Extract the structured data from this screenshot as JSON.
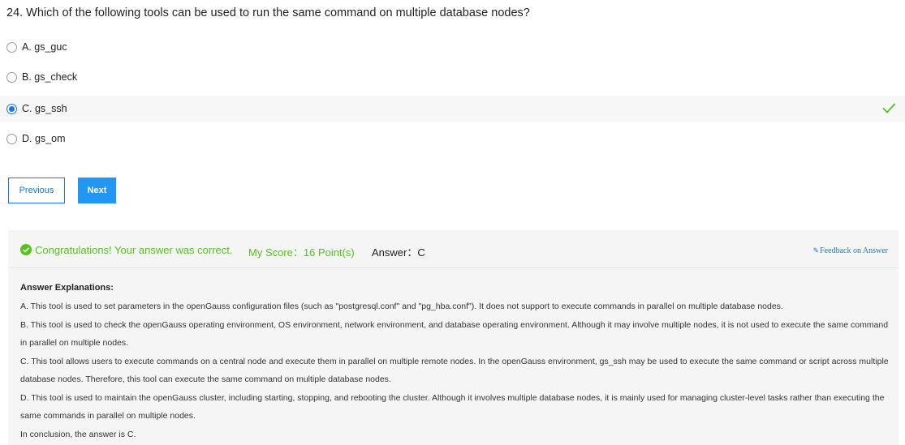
{
  "question": {
    "text": "24. Which of the following tools can be used to run the same command on multiple database nodes?"
  },
  "options": [
    {
      "label": "A. gs_guc",
      "selected": false,
      "correct": false
    },
    {
      "label": "B. gs_check",
      "selected": false,
      "correct": false
    },
    {
      "label": "C. gs_ssh",
      "selected": true,
      "correct": true
    },
    {
      "label": "D. gs_om",
      "selected": false,
      "correct": false
    }
  ],
  "buttons": {
    "previous": "Previous",
    "next": "Next"
  },
  "result": {
    "message": "Congratulations! Your answer was correct.",
    "score": "My Score：16 Point(s)",
    "answer": "Answer：C",
    "feedback": "Feedback on Answer"
  },
  "explanation": {
    "title": "Answer Explanations:",
    "lines": [
      "A. This tool is used to set parameters in the openGauss configuration files (such as \"postgresql.conf\" and \"pg_hba.conf\"). It does not support to execute commands in parallel on multiple database nodes.",
      "B. This tool is used to check the openGauss operating environment, OS environment, network environment, and database operating environment. Although it may involve multiple nodes, it is not used to execute the same command in parallel on multiple nodes.",
      "C. This tool allows users to execute commands on a central node and execute them in parallel on multiple remote nodes. In the openGauss environment, gs_ssh may be used to execute the same command or script across multiple database nodes. Therefore, this tool can execute the same command on multiple database nodes.",
      "D. This tool is used to maintain the openGauss cluster, including starting, stopping, and rebooting the cluster. Although it involves multiple database nodes, it is mainly used for managing cluster-level tasks rather than executing the same commands in parallel on multiple nodes.",
      "In conclusion, the answer is C."
    ]
  },
  "colors": {
    "accent": "#1a73e8",
    "success": "#52c41a",
    "panel": "#f5f5f5"
  }
}
